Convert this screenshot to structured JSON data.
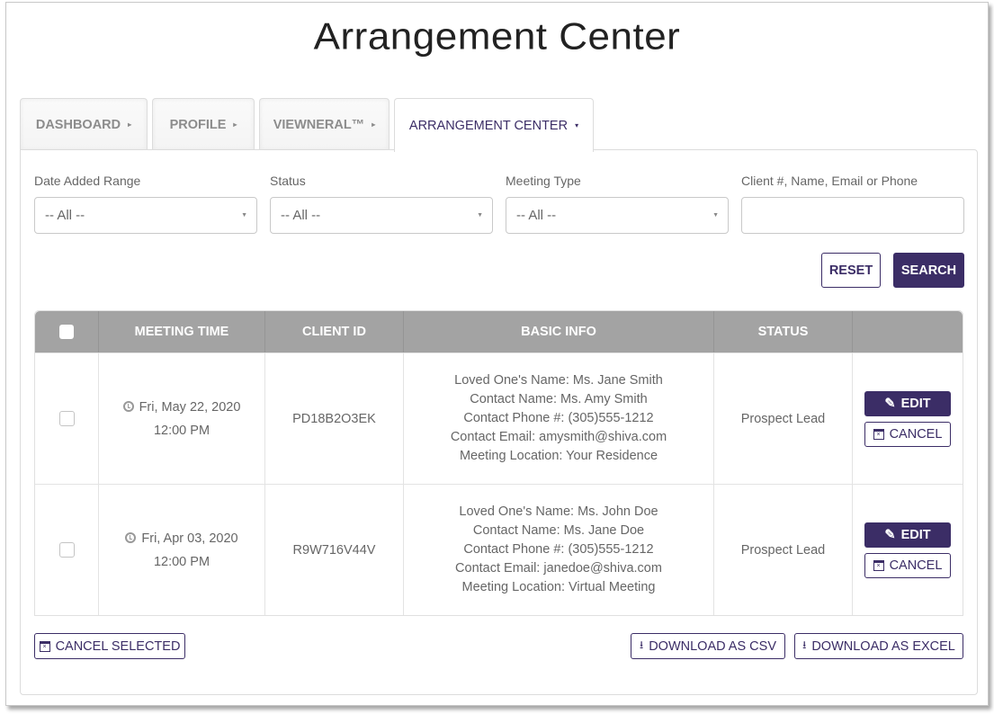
{
  "page": {
    "title": "Arrangement Center"
  },
  "tabs": [
    {
      "label": "DASHBOARD",
      "caret": "▸",
      "active": false
    },
    {
      "label": "PROFILE",
      "caret": "▸",
      "active": false
    },
    {
      "label": "VIEWNERAL™",
      "caret": "▸",
      "active": false
    },
    {
      "label": "ARRANGEMENT CENTER",
      "caret": "▾",
      "active": true
    }
  ],
  "filters": {
    "date_range": {
      "label": "Date Added Range",
      "value": "-- All --"
    },
    "status": {
      "label": "Status",
      "value": "-- All --"
    },
    "meeting_type": {
      "label": "Meeting Type",
      "value": "-- All --"
    },
    "search": {
      "label": "Client #, Name, Email or Phone",
      "value": "",
      "placeholder": ""
    }
  },
  "buttons": {
    "reset": "RESET",
    "search": "SEARCH",
    "cancel_selected": "CANCEL SELECTED",
    "download_csv": "DOWNLOAD AS CSV",
    "download_excel": "DOWNLOAD AS EXCEL"
  },
  "table": {
    "headers": [
      "",
      "MEETING TIME",
      "CLIENT ID",
      "BASIC INFO",
      "STATUS",
      ""
    ],
    "rows": [
      {
        "checked": false,
        "date": "Fri, May 22, 2020",
        "time": "12:00 PM",
        "client_id": "PD18B2O3EK",
        "info": [
          "Loved One's Name: Ms. Jane Smith",
          "Contact Name: Ms. Amy Smith",
          "Contact Phone #: (305)555-1212",
          "Contact Email: amysmith@shiva.com",
          "Meeting Location: Your Residence"
        ],
        "status": "Prospect Lead",
        "edit_label": "EDIT",
        "cancel_label": "CANCEL"
      },
      {
        "checked": false,
        "date": "Fri, Apr 03, 2020",
        "time": "12:00 PM",
        "client_id": "R9W716V44V",
        "info": [
          "Loved One's Name: Ms. John Doe",
          "Contact Name: Ms. Jane Doe",
          "Contact Phone #: (305)555-1212",
          "Contact Email: janedoe@shiva.com",
          "Meeting Location: Virtual Meeting"
        ],
        "status": "Prospect Lead",
        "edit_label": "EDIT",
        "cancel_label": "CANCEL"
      }
    ]
  },
  "colors": {
    "brand": "#3b2d66",
    "header_bg": "#a3a3a3"
  }
}
